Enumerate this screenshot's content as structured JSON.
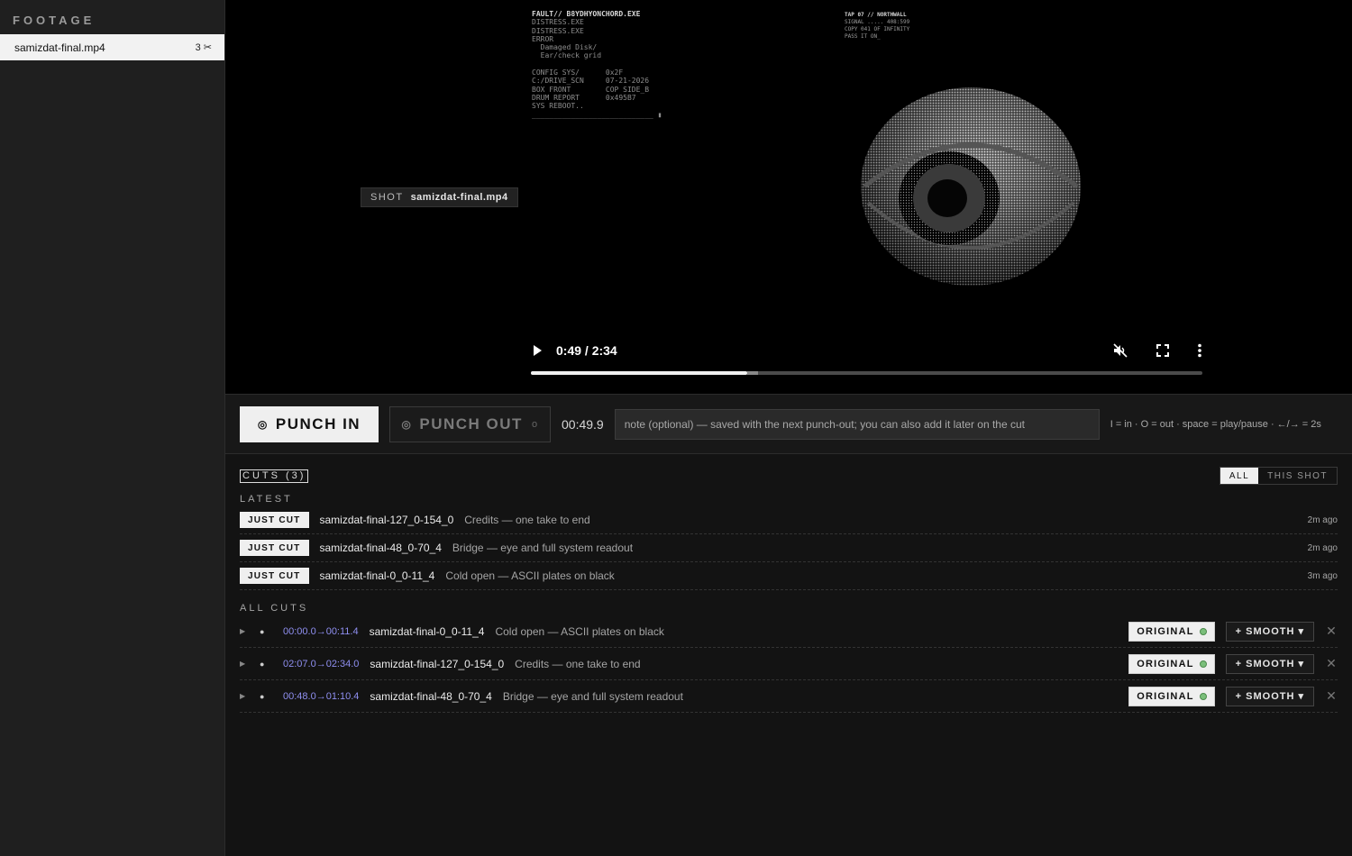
{
  "sidebar": {
    "title": "FOOTAGE",
    "files": [
      {
        "name": "samizdat-final.mp4",
        "count": "3 ✂"
      }
    ]
  },
  "player": {
    "ascii_left": [
      "FAULT// B8YDHYONCHORD.EXE",
      "DISTRESS.EXE",
      "DISTRESS.EXE",
      "ERROR",
      "  Damaged Disk/",
      "  Ear/check grid",
      "",
      "CONFIG SYS/      0x2F",
      "C:/DRIVE_SCN     07-21-2026",
      "BOX FRONT        COP SIDE_B",
      "DRUM REPORT      0x495B7",
      "SYS REBOOT..",
      "____________________________ ▮"
    ],
    "ascii_right": [
      "TAP 07 // NORTHWALL",
      "SIGNAL ..... 408:599",
      "COPY 041 OF INFINITY",
      "PASS IT ON_"
    ],
    "shot_key": "SHOT",
    "shot_value": "samizdat-final.mp4",
    "time": "0:49 / 2:34",
    "progress": 0.322,
    "buffered": 0.338
  },
  "punch": {
    "in_label": "PUNCH IN",
    "out_label": "PUNCH OUT",
    "out_suffix": "o",
    "timecode": "00:49.9",
    "note_placeholder": "note (optional) — saved with the next punch-out; you can also add it later on the cut",
    "hints": "I = in · O = out · space = play/pause · ←/→ = 2s"
  },
  "cuts": {
    "title": "CUTS (3)",
    "toggle": {
      "all": "ALL",
      "this_shot": "THIS SHOT"
    },
    "latest_label": "LATEST",
    "latest": [
      {
        "badge": "JUST CUT",
        "name": "samizdat-final-127_0-154_0",
        "note": "Credits — one take to end",
        "ago": "2m ago"
      },
      {
        "badge": "JUST CUT",
        "name": "samizdat-final-48_0-70_4",
        "note": "Bridge — eye and full system readout",
        "ago": "2m ago"
      },
      {
        "badge": "JUST CUT",
        "name": "samizdat-final-0_0-11_4",
        "note": "Cold open — ASCII plates on black",
        "ago": "3m ago"
      }
    ],
    "all_label": "ALL CUTS",
    "all": [
      {
        "range": "00:00.0→00:11.4",
        "name": "samizdat-final-0_0-11_4",
        "note": "Cold open — ASCII plates on black",
        "original": "ORIGINAL",
        "smooth": "+ SMOOTH ▾"
      },
      {
        "range": "02:07.0→02:34.0",
        "name": "samizdat-final-127_0-154_0",
        "note": "Credits — one take to end",
        "original": "ORIGINAL",
        "smooth": "+ SMOOTH ▾"
      },
      {
        "range": "00:48.0→01:10.4",
        "name": "samizdat-final-48_0-70_4",
        "note": "Bridge — eye and full system readout",
        "original": "ORIGINAL",
        "smooth": "+ SMOOTH ▾"
      }
    ]
  },
  "colors": {
    "accent_range": "#8f8ff0",
    "status_green": "#7bbf7b"
  }
}
